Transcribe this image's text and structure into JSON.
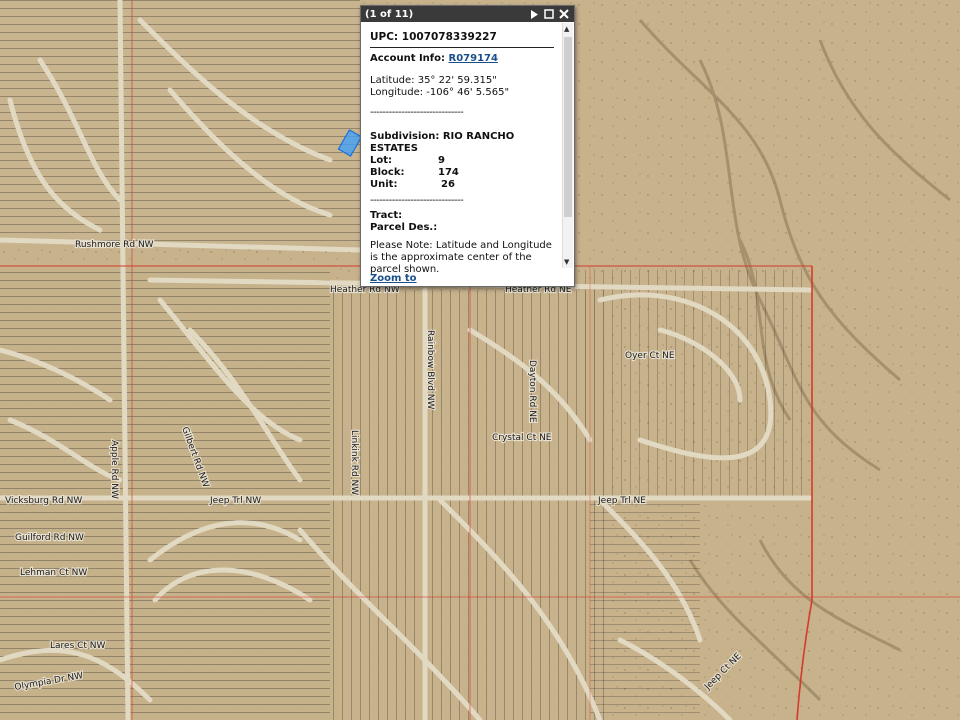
{
  "map": {
    "colors": {
      "terrain_base": "#c9b48e",
      "terrain_dark": "#a28c66",
      "lot_line": "#2c2a24",
      "road": "#dcd3bd",
      "boundary": "#d63a2a",
      "selected_parcel": "#3ea0ff"
    },
    "road_labels": [
      {
        "text": "Rushmore Rd NW",
        "icon": "road-label"
      },
      {
        "text": "Heather Rd NW",
        "icon": "road-label"
      },
      {
        "text": "Heather Rd NE",
        "icon": "road-label"
      },
      {
        "text": "Vicksburg Rd NW",
        "icon": "road-label"
      },
      {
        "text": "Jeep Trl NW",
        "icon": "road-label"
      },
      {
        "text": "Jeep Trl NE",
        "icon": "road-label"
      },
      {
        "text": "Crystal Ct NE",
        "icon": "road-label"
      },
      {
        "text": "Rainbow Blvd NW",
        "icon": "road-label"
      },
      {
        "text": "Linkink Rd NW",
        "icon": "road-label"
      },
      {
        "text": "Gilbert Rd NW",
        "icon": "road-label"
      },
      {
        "text": "Apple Rd NW",
        "icon": "road-label"
      },
      {
        "text": "Lares Ct NW",
        "icon": "road-label"
      },
      {
        "text": "Guilford Rd NW",
        "icon": "road-label"
      },
      {
        "text": "Lehman Ct NW",
        "icon": "road-label"
      },
      {
        "text": "Olympia Dr NW",
        "icon": "road-label"
      },
      {
        "text": "Dayton Rd NE",
        "icon": "road-label"
      },
      {
        "text": "Oyer Ct NE",
        "icon": "road-label"
      },
      {
        "text": "Jeep Ct NE",
        "icon": "road-label"
      }
    ]
  },
  "popup": {
    "count": "(1 of 11)",
    "upc": "UPC: 1007078339227",
    "account_label": "Account Info:",
    "account_link": "R079174",
    "latitude": "Latitude: 35° 22' 59.315\"",
    "longitude": "Longitude: -106° 46' 5.565\"",
    "separator": "------------------------------",
    "subdivision": "Subdivision: RIO RANCHO ESTATES",
    "lot_label": "Lot:",
    "lot_value": "9",
    "block_label": "Block:",
    "block_value": "174",
    "unit_label": "Unit:",
    "unit_value": "26",
    "tract": "Tract:",
    "parcel_des": "Parcel Des.:",
    "note": "Please Note: Latitude and Longitude is the approximate center of the parcel shown.",
    "zoom_to": "Zoom to",
    "icons": [
      "next-icon",
      "maximize-icon",
      "close-icon"
    ]
  }
}
